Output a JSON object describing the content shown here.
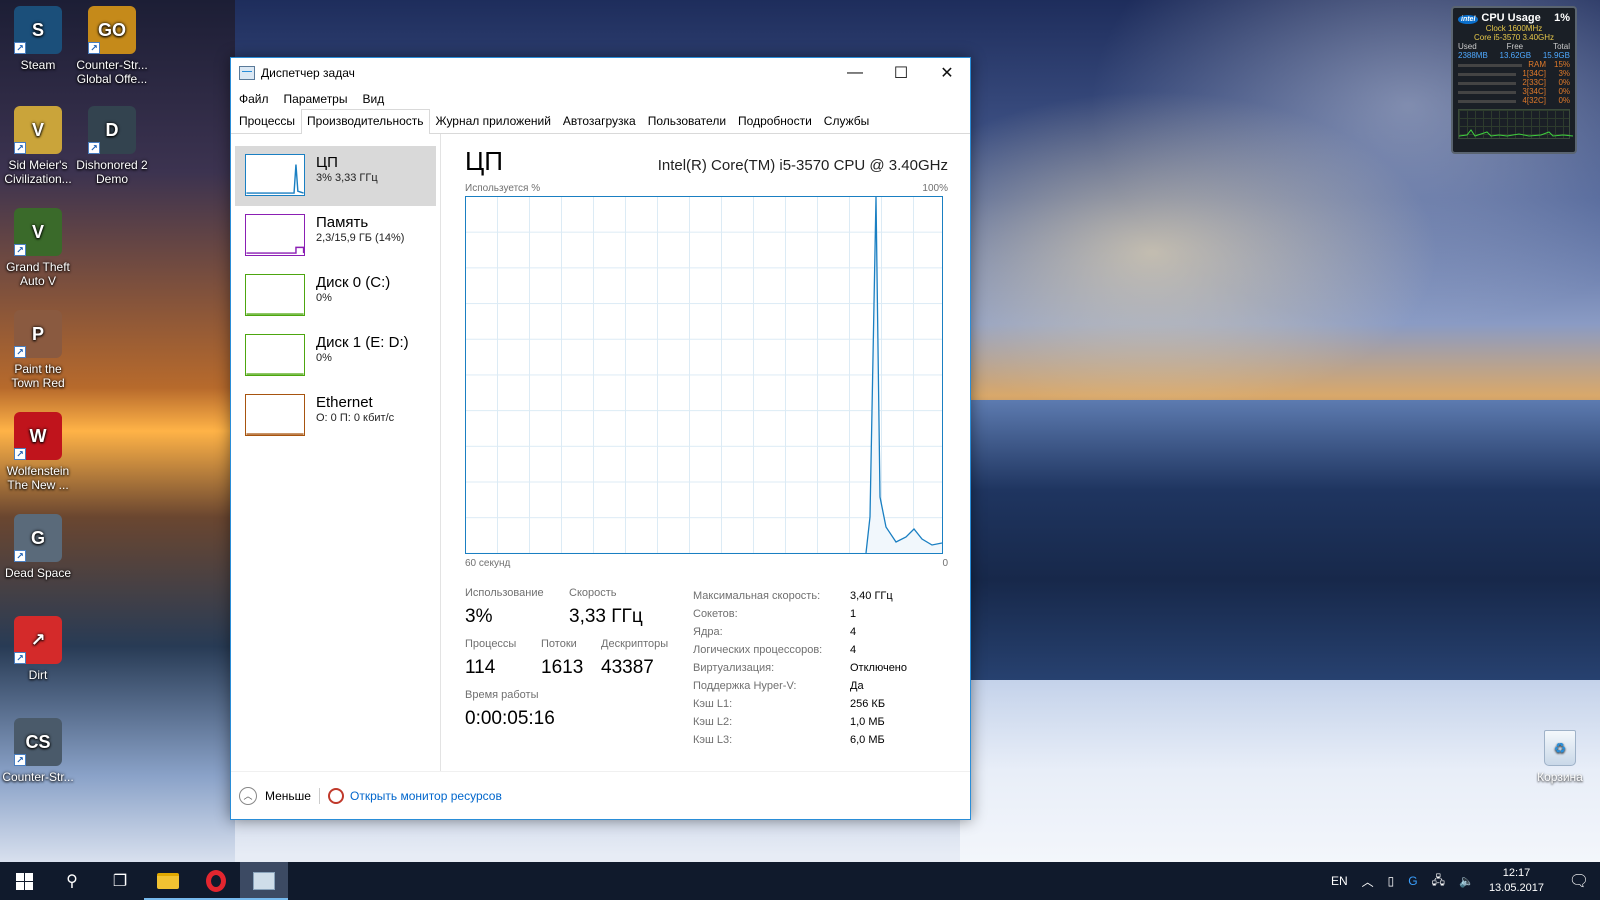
{
  "desktop": {
    "icons": [
      {
        "label": "Steam",
        "icon": "steam-icon",
        "color": "#1b4f7a",
        "glyph": "S"
      },
      {
        "label": "Counter-Str... Global Offe...",
        "icon": "csgo-icon",
        "color": "#c58a1a",
        "glyph": "GO"
      },
      {
        "label": "Sid Meier's Civilization...",
        "icon": "civilization-icon",
        "color": "#caa43a",
        "glyph": "V"
      },
      {
        "label": "Dishonored 2 Demo",
        "icon": "dishonored-icon",
        "color": "#33434f",
        "glyph": "D"
      },
      {
        "label": "Grand Theft Auto V",
        "icon": "gta-icon",
        "color": "#3a6a2a",
        "glyph": "V"
      },
      {
        "label": "Paint the Town Red",
        "icon": "paint-town-red-icon",
        "color": "#8a5a40",
        "glyph": "P"
      },
      {
        "label": "Wolfenstein The New ...",
        "icon": "wolfenstein-icon",
        "color": "#c0141c",
        "glyph": "W"
      },
      {
        "label": "Dead Space",
        "icon": "dead-space-icon",
        "color": "#5a6a7a",
        "glyph": "G"
      },
      {
        "label": "Dirt",
        "icon": "dirt-icon",
        "color": "#d42a2a",
        "glyph": "↗"
      },
      {
        "label": "Counter-Str...",
        "icon": "counter-strike-icon",
        "color": "#4a5a6a",
        "glyph": "CS"
      }
    ],
    "recycle_bin": "Корзина"
  },
  "gadget": {
    "logo": "intel",
    "title": "CPU Usage",
    "percent": "1%",
    "clock": "Clock 1600MHz",
    "cpu_model": "Core i5-3570 3.40GHz",
    "headers": [
      "Used",
      "Free",
      "Total"
    ],
    "mem_values": [
      "2388MB",
      "13.62GB",
      "15.9GB"
    ],
    "ram_label": "RAM",
    "ram_percent": "15%",
    "cores": [
      {
        "label": "1[34C]",
        "pct": "3%"
      },
      {
        "label": "2[33C]",
        "pct": "0%"
      },
      {
        "label": "3[34C]",
        "pct": "0%"
      },
      {
        "label": "4[32C]",
        "pct": "0%"
      }
    ]
  },
  "window": {
    "title": "Диспетчер задач",
    "menu": [
      "Файл",
      "Параметры",
      "Вид"
    ],
    "tabs": [
      "Процессы",
      "Производительность",
      "Журнал приложений",
      "Автозагрузка",
      "Пользователи",
      "Подробности",
      "Службы"
    ],
    "active_tab": "Производительность",
    "resources": [
      {
        "name": "ЦП",
        "value": "3% 3,33 ГГц",
        "color": "#1a7fc2"
      },
      {
        "name": "Память",
        "value": "2,3/15,9 ГБ (14%)",
        "color": "#8b1fb4"
      },
      {
        "name": "Диск 0 (C:)",
        "value": "0%",
        "color": "#4da60f"
      },
      {
        "name": "Диск 1 (E: D:)",
        "value": "0%",
        "color": "#4da60f"
      },
      {
        "name": "Ethernet",
        "value": "О: 0 П: 0 кбит/с",
        "color": "#a7540f"
      }
    ],
    "main": {
      "title": "ЦП",
      "cpu_name": "Intel(R) Core(TM) i5-3570 CPU @ 3.40GHz",
      "graph_label_left": "Используется %",
      "graph_label_right": "100%",
      "graph_foot_left": "60 секунд",
      "graph_foot_right": "0",
      "usage_label": "Использование",
      "usage_value": "3%",
      "speed_label": "Скорость",
      "speed_value": "3,33 ГГц",
      "processes_label": "Процессы",
      "processes_value": "114",
      "threads_label": "Потоки",
      "threads_value": "1613",
      "handles_label": "Дескрипторы",
      "handles_value": "43387",
      "uptime_label": "Время работы",
      "uptime_value": "0:00:05:16",
      "specs": [
        {
          "k": "Максимальная скорость:",
          "v": "3,40 ГГц"
        },
        {
          "k": "Сокетов:",
          "v": "1"
        },
        {
          "k": "Ядра:",
          "v": "4"
        },
        {
          "k": "Логических процессоров:",
          "v": "4"
        },
        {
          "k": "Виртуализация:",
          "v": "Отключено"
        },
        {
          "k": "Поддержка Hyper-V:",
          "v": "Да"
        },
        {
          "k": "Кэш L1:",
          "v": "256 КБ"
        },
        {
          "k": "Кэш L2:",
          "v": "1,0 МБ"
        },
        {
          "k": "Кэш L3:",
          "v": "6,0 МБ"
        }
      ]
    },
    "footer": {
      "less_label": "Меньше",
      "resmon_label": "Открыть монитор ресурсов"
    }
  },
  "taskbar": {
    "lang": "EN",
    "time": "12:17",
    "date": "13.05.2017"
  }
}
